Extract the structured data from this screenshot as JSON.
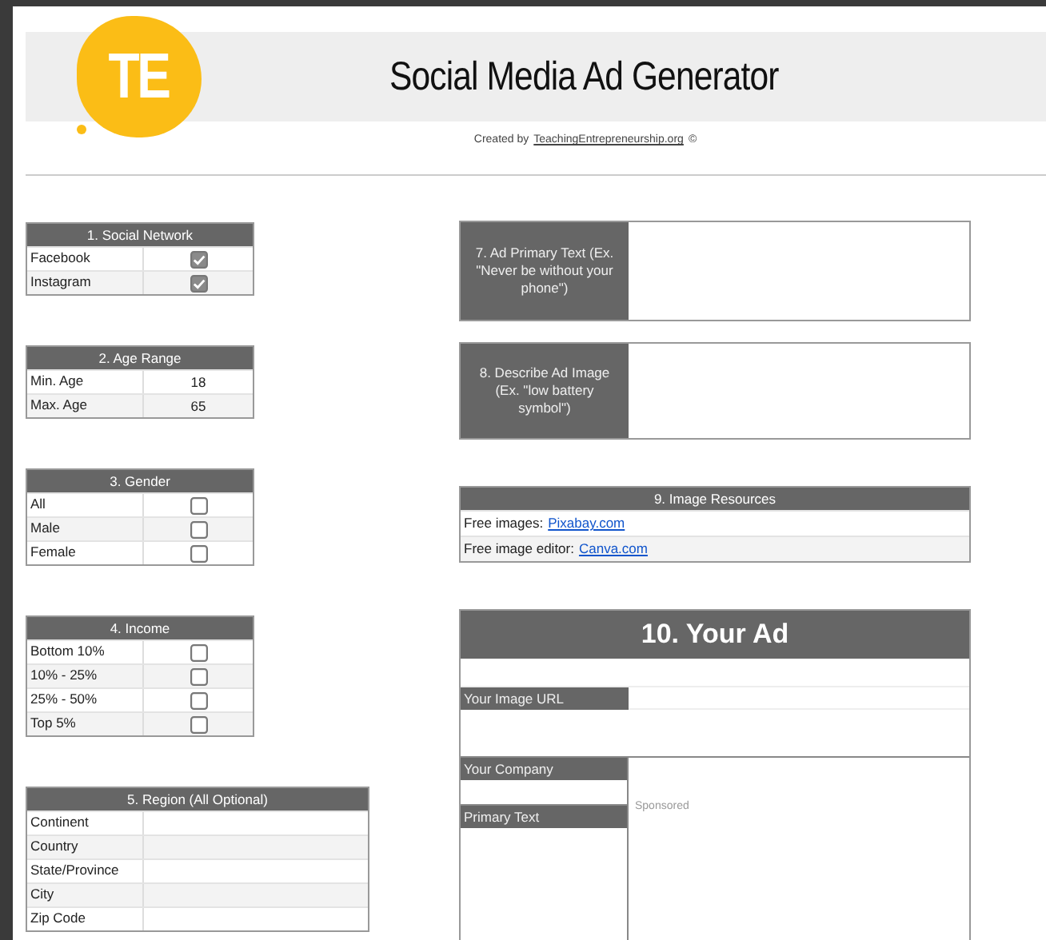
{
  "header": {
    "logo": "TE",
    "title": "Social Media Ad Generator",
    "credit_prefix": "Created by",
    "credit_link": "TeachingEntrepreneurship.org",
    "credit_suffix": "©"
  },
  "left_tables": [
    {
      "title": "1. Social Network",
      "wide": false,
      "rows": [
        {
          "kind": "check",
          "label": "Facebook",
          "checked": true
        },
        {
          "kind": "check",
          "label": "Instagram",
          "checked": true
        }
      ]
    },
    {
      "title": "2. Age Range",
      "wide": false,
      "rows": [
        {
          "kind": "value",
          "label": "Min. Age",
          "value": "18"
        },
        {
          "kind": "value",
          "label": "Max. Age",
          "value": "65"
        }
      ]
    },
    {
      "title": "3. Gender",
      "wide": false,
      "rows": [
        {
          "kind": "check",
          "label": "All",
          "checked": false
        },
        {
          "kind": "check",
          "label": "Male",
          "checked": false
        },
        {
          "kind": "check",
          "label": "Female",
          "checked": false
        }
      ]
    },
    {
      "title": "4. Income",
      "wide": false,
      "rows": [
        {
          "kind": "check",
          "label": "Bottom 10%",
          "checked": false
        },
        {
          "kind": "check",
          "label": "10% - 25%",
          "checked": false
        },
        {
          "kind": "check",
          "label": "25% - 50%",
          "checked": false
        },
        {
          "kind": "check",
          "label": "Top 5%",
          "checked": false
        }
      ]
    },
    {
      "title": "5. Region (All Optional)",
      "wide": true,
      "rows": [
        {
          "kind": "value",
          "label": "Continent"
        },
        {
          "kind": "value",
          "label": "Country"
        },
        {
          "kind": "value",
          "label": "State/Province"
        },
        {
          "kind": "value",
          "label": "City"
        },
        {
          "kind": "value",
          "label": "Zip Code"
        }
      ]
    }
  ],
  "ad_primary_text": {
    "label": "7. Ad Primary Text (Ex. \"Never be without your phone\")"
  },
  "ad_image": {
    "label": "8. Describe Ad Image (Ex. \"low battery symbol\")"
  },
  "image_resources": {
    "title": "9. Image Resources",
    "rows": [
      {
        "text": "Free images:",
        "link": "Pixabay.com"
      },
      {
        "text": "Free image editor:",
        "link": "Canva.com"
      }
    ]
  },
  "your_ad": {
    "title": "10. Your Ad",
    "image_url_label": "Your Image URL",
    "company_label": "Your Company",
    "primary_text_label": "Primary Text",
    "sponsored": "Sponsored"
  }
}
